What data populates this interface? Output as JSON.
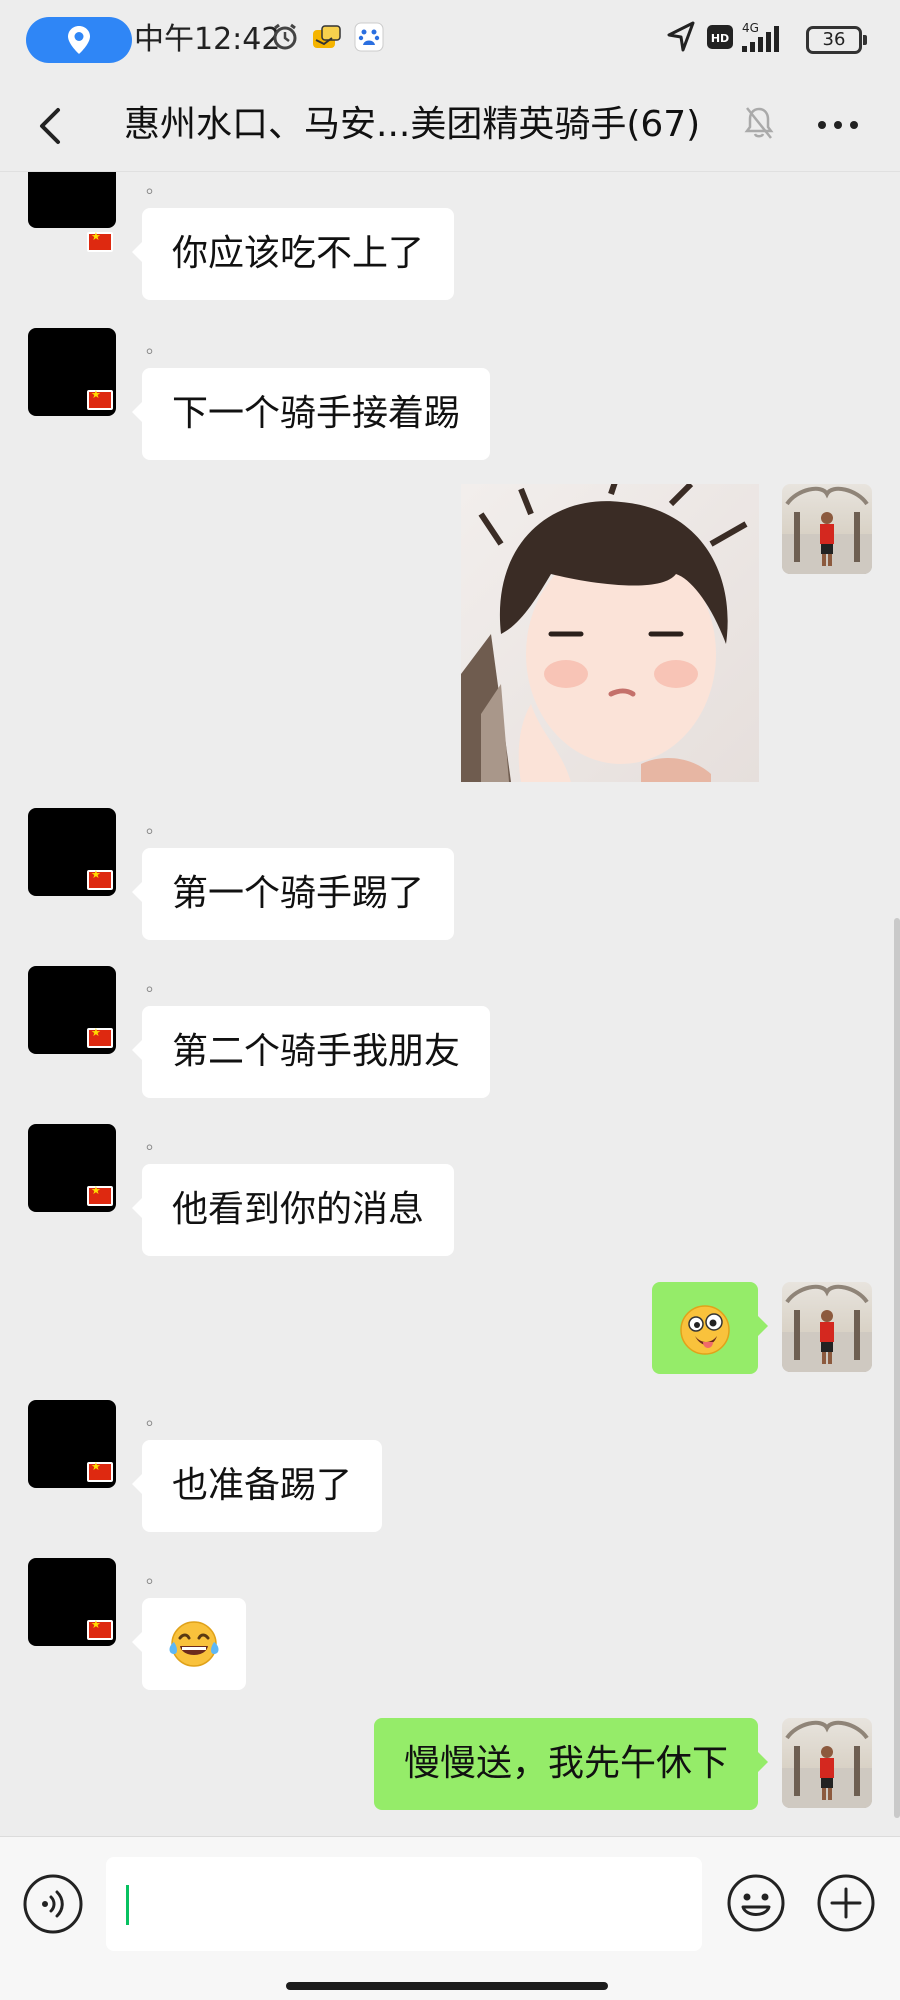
{
  "status_bar": {
    "time": "中午12:42",
    "network": "4G",
    "hd_badge": "HD",
    "battery": "36",
    "icons": [
      "location-icon",
      "alarm-icon",
      "notification-app-icon",
      "baidu-icon",
      "navigation-icon",
      "signal-icon"
    ]
  },
  "header": {
    "title": "惠州水口、马安...美团精英骑手(67)",
    "icons": [
      "back-icon",
      "mute-bell-icon",
      "more-icon"
    ]
  },
  "messages": [
    {
      "sender": "other",
      "nick": "。",
      "text": "你应该吃不上了"
    },
    {
      "sender": "other",
      "nick": "。",
      "text": "下一个骑手接着踢"
    },
    {
      "sender": "me",
      "type": "sticker",
      "icon": "crying-baby-sticker"
    },
    {
      "sender": "other",
      "nick": "。",
      "text": "第一个骑手踢了"
    },
    {
      "sender": "other",
      "nick": "。",
      "text": "第二个骑手我朋友"
    },
    {
      "sender": "other",
      "nick": "。",
      "text": "他看到你的消息"
    },
    {
      "sender": "me",
      "type": "emoji",
      "icon": "crazy-face-emoji"
    },
    {
      "sender": "other",
      "nick": "。",
      "text": "也准备踢了"
    },
    {
      "sender": "other",
      "nick": "。",
      "type": "emoji",
      "icon": "tears-of-joy-emoji"
    },
    {
      "sender": "me",
      "text": "慢慢送，我先午休下"
    }
  ],
  "input_bar": {
    "value": "",
    "icons": [
      "voice-icon",
      "emoji-icon",
      "plus-icon"
    ]
  },
  "colors": {
    "background": "#ededed",
    "my_bubble": "#95ec69",
    "their_bubble": "#ffffff",
    "caret": "#07c160",
    "location_pill": "#2f86f6"
  }
}
